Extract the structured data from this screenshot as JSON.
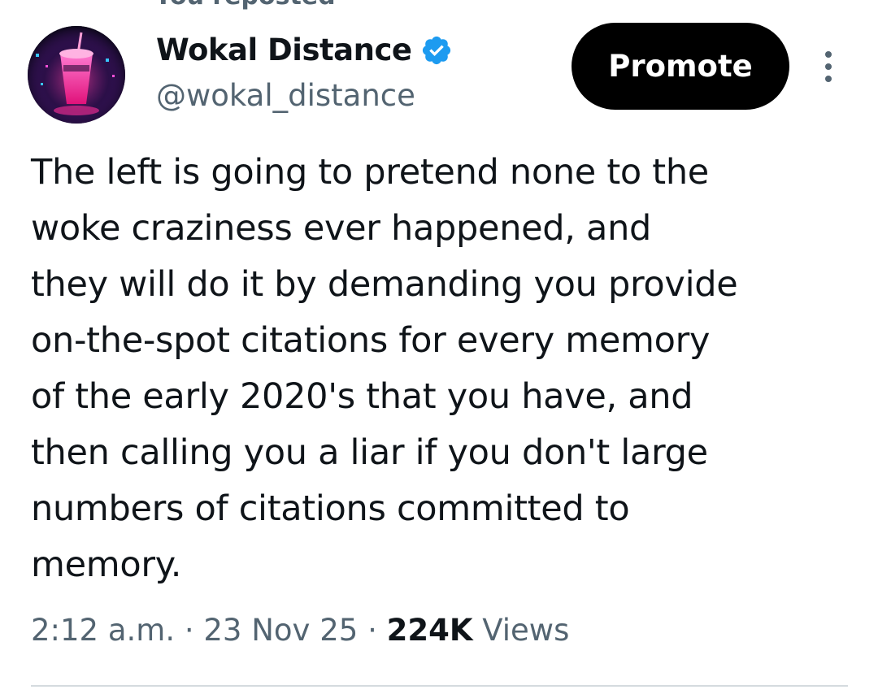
{
  "header": {
    "reposted_label": "You reposted"
  },
  "author": {
    "display_name": "Wokal Distance",
    "handle": "@wokal_distance",
    "verified": true,
    "verified_color": "#1d9bf0"
  },
  "actions": {
    "promote_label": "Promote",
    "more_icon": "more-vertical-icon"
  },
  "tweet": {
    "text": "The left is going to pretend none to the\nwoke craziness ever happened, and\nthey will do it by demanding you provide\non-the-spot citations for every memory\nof the early 2020's that you have, and\nthen calling you a liar if you don't large\nnumbers of citations committed to\nmemory.",
    "time": "2:12 a.m.",
    "separator": "·",
    "date": "23 Nov 25",
    "views_count": "224K",
    "views_label": "Views"
  },
  "colors": {
    "text_primary": "#0f1419",
    "text_secondary": "#536471",
    "button_bg": "#000000",
    "button_text": "#ffffff",
    "divider": "#d5dbdf"
  }
}
